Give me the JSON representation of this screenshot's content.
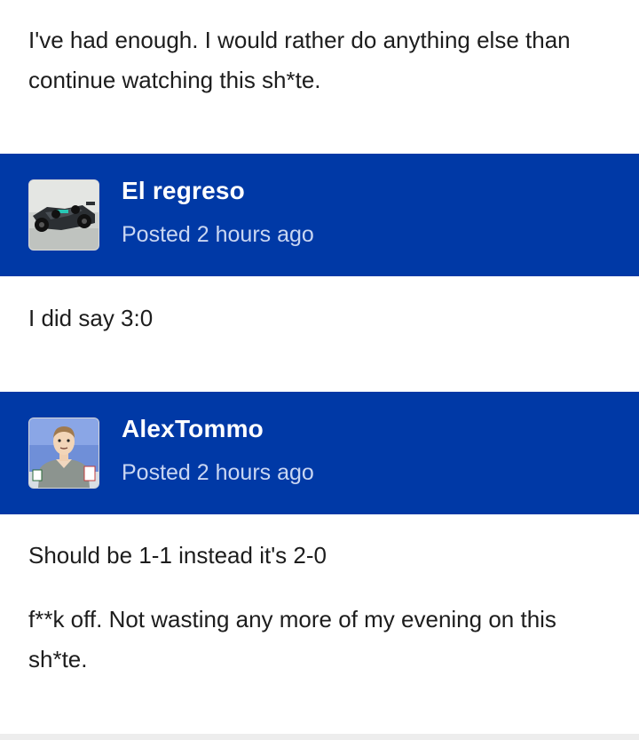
{
  "posts": [
    {
      "paragraphs": [
        "I've had enough. I would rather do anything else than continue watching this sh*te."
      ]
    },
    {
      "username": "El regreso",
      "avatar_icon": "race-car-avatar",
      "posted": "Posted 2 hours ago",
      "paragraphs": [
        "I did say 3:0"
      ]
    },
    {
      "username": "AlexTommo",
      "avatar_icon": "cartoon-man-avatar",
      "posted": "Posted 2 hours ago",
      "paragraphs": [
        "Should be 1-1 instead it's 2-0",
        "f**k off. Not wasting any more of my evening on this sh*te."
      ]
    }
  ],
  "colors": {
    "header_bg": "#0039a6",
    "header_text": "#ffffff",
    "meta_text": "#c9d6f2",
    "body_text": "#1d1d1d"
  }
}
